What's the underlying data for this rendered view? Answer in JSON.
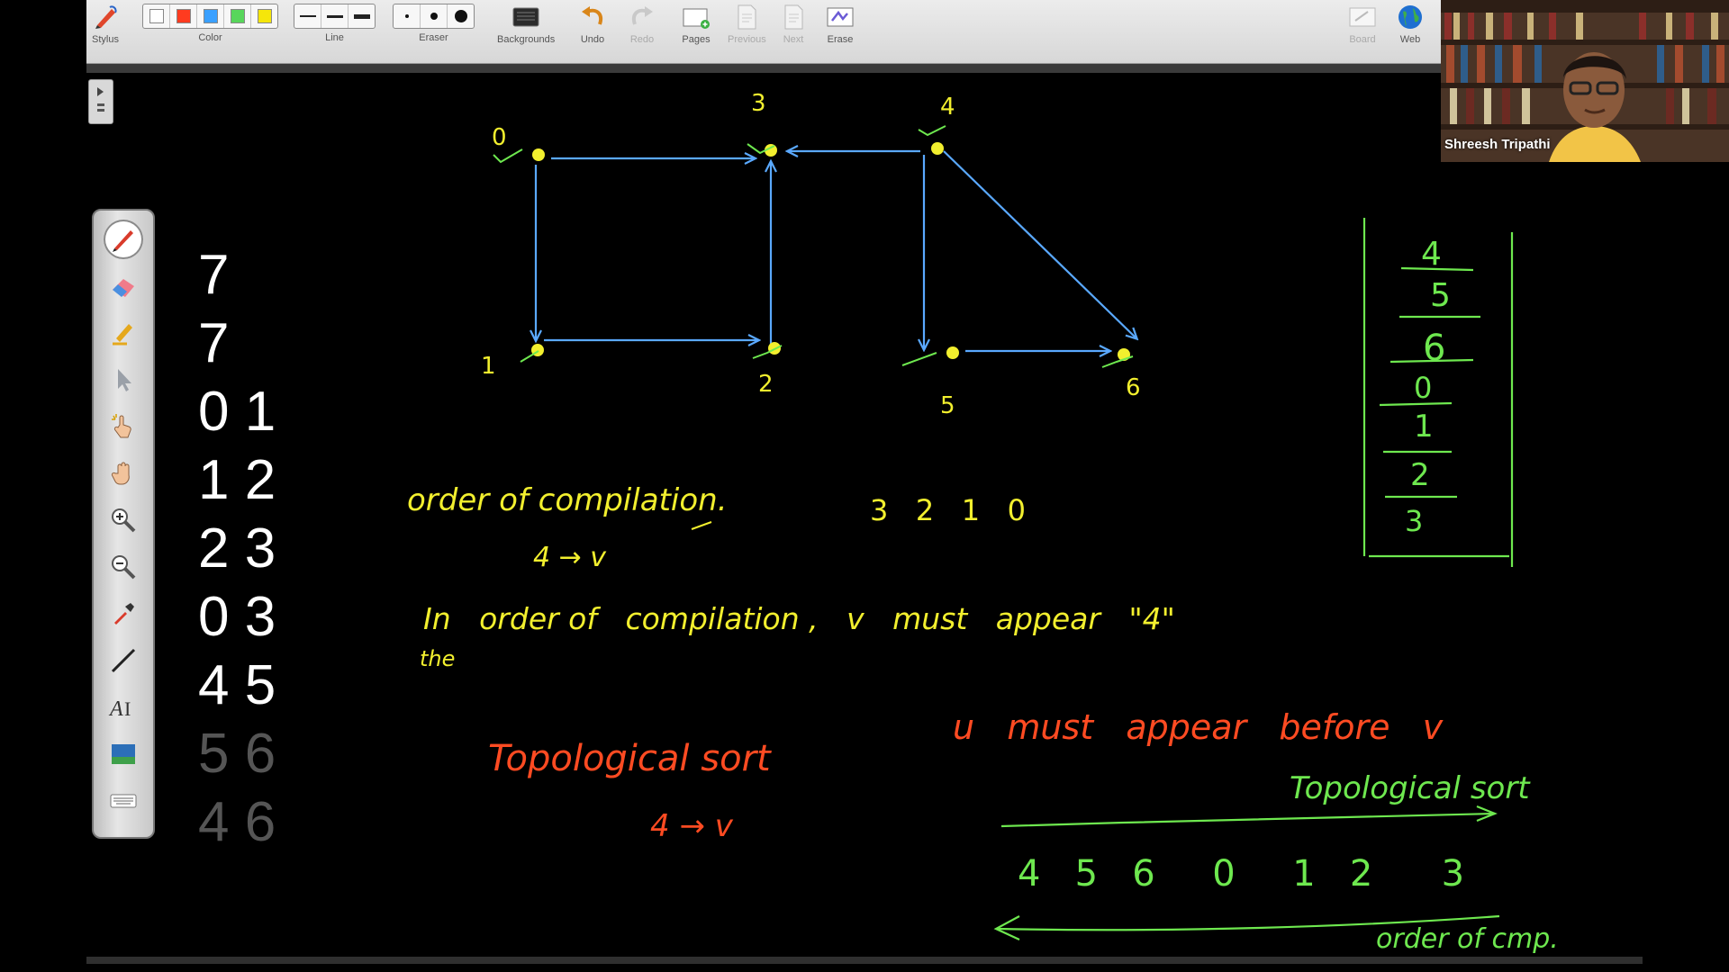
{
  "toolbar": {
    "stylus": "Stylus",
    "color": "Color",
    "line": "Line",
    "eraser": "Eraser",
    "backgrounds": "Backgrounds",
    "undo": "Undo",
    "redo": "Redo",
    "pages": "Pages",
    "previous": "Previous",
    "next": "Next",
    "erase": "Erase",
    "board": "Board",
    "web": "Web",
    "colors": [
      "#ffffff",
      "#ff3b1f",
      "#3aa0ff",
      "#58d65b",
      "#f5e60a"
    ]
  },
  "palette": {
    "tools": [
      "pen-icon",
      "eraser-icon",
      "highlighter-icon",
      "pointer-icon",
      "magic-hand-icon",
      "hand-icon",
      "zoom-in-icon",
      "zoom-out-icon",
      "eyedropper-icon",
      "line-icon",
      "text-icon",
      "screen-capture-icon",
      "keyboard-icon"
    ]
  },
  "input_pairs": [
    {
      "text": "7",
      "dim": false
    },
    {
      "text": "7",
      "dim": false
    },
    {
      "text": "0 1",
      "dim": false
    },
    {
      "text": "1 2",
      "dim": false
    },
    {
      "text": "2 3",
      "dim": false
    },
    {
      "text": "0 3",
      "dim": false
    },
    {
      "text": "4 5",
      "dim": false
    },
    {
      "text": "5 6",
      "dim": true
    },
    {
      "text": "4 6",
      "dim": true
    }
  ],
  "graph": {
    "nodes": [
      "0",
      "1",
      "2",
      "3",
      "4",
      "5",
      "6"
    ]
  },
  "notes": {
    "order_of_compilation": "order of compilation.",
    "u_to_v": "4 → v",
    "reverse_sequence": "3   2   1   0",
    "statement_line1": "In   order of   compilation ,   v   must   appear   \"4\"",
    "statement_line2": "the",
    "topo_sort": "Topological sort",
    "topo_u_to_v": "4 → v",
    "u_before_v": "u   must   appear   before   v",
    "topo_sort_arrow": "Topological sort",
    "topo_sequence": "4   5   6     0     1   2      3",
    "order_of_compilation_arrow": "order of cmp."
  },
  "stack": [
    "4",
    "5",
    "6",
    "0",
    "1",
    "2",
    "3"
  ],
  "webcam": {
    "name": "Shreesh Tripathi"
  }
}
